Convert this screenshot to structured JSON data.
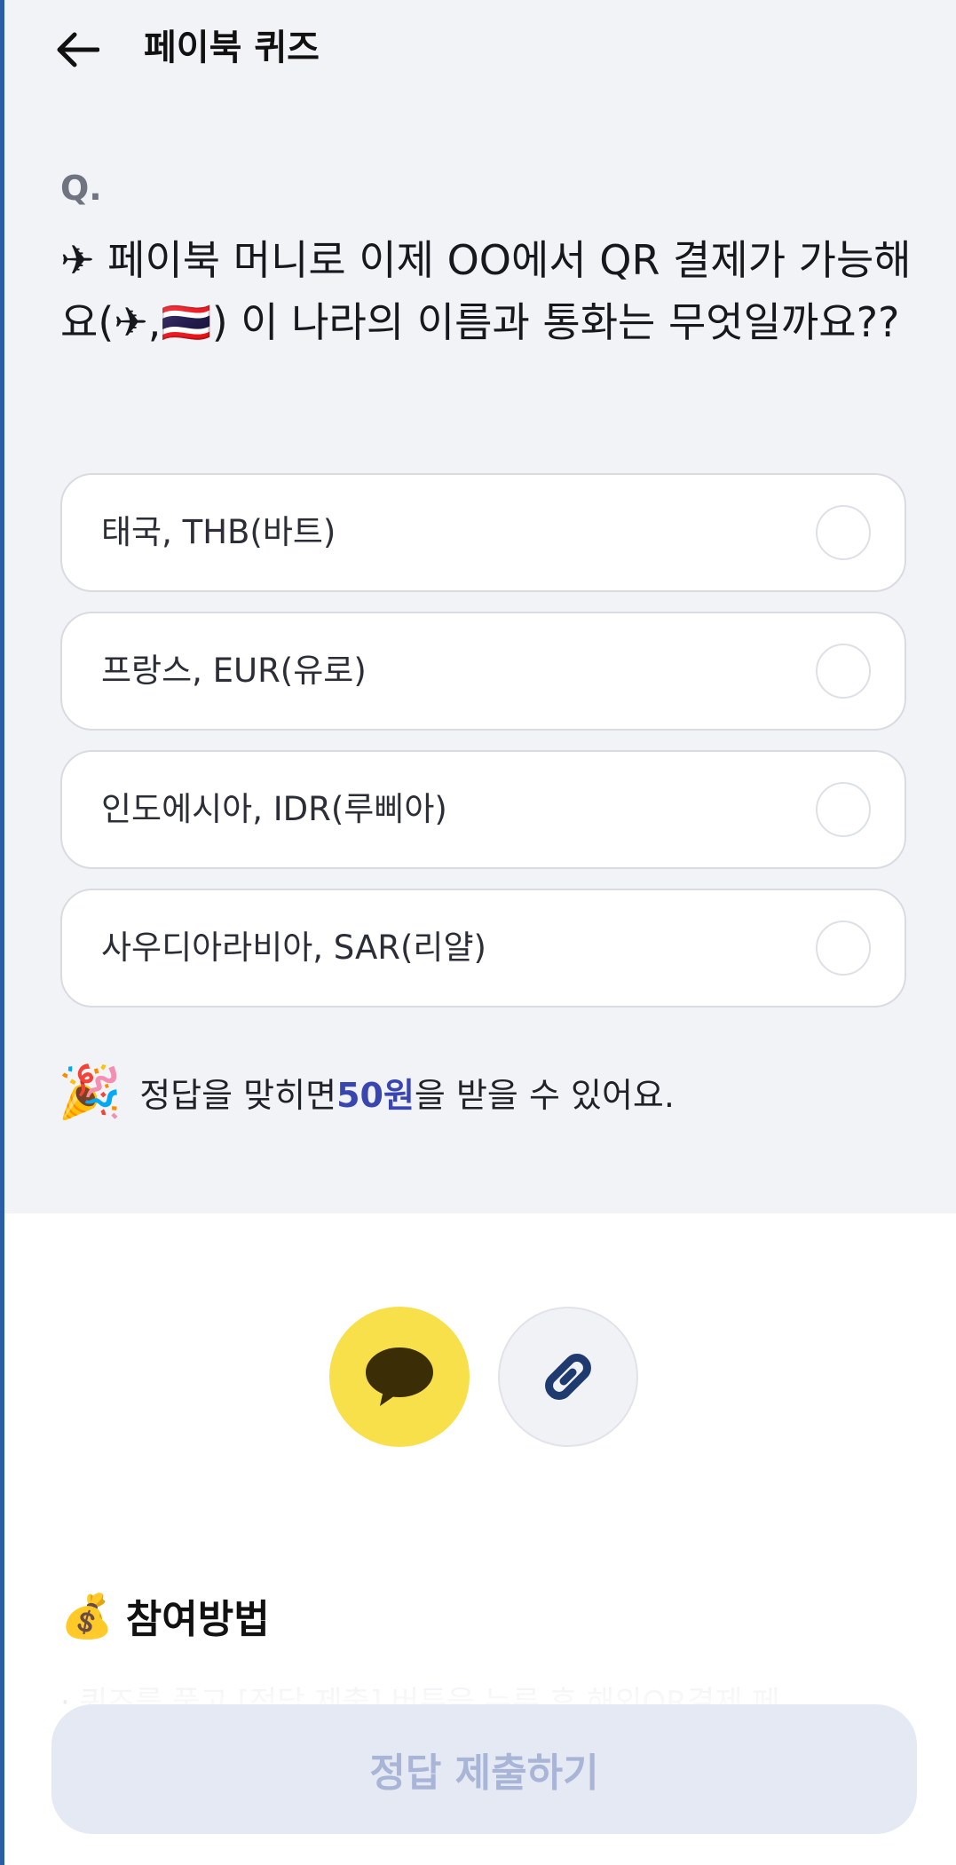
{
  "header": {
    "title": "페이북 퀴즈",
    "back_icon": "arrow-left-icon"
  },
  "quiz": {
    "q_label": "Q.",
    "question": "✈ 페이북 머니로 이제 OO에서 QR 결제가 가능해요(✈,🇹🇭) 이 나라의 이름과 통화는 무엇일까요??",
    "options": [
      {
        "label": "태국, THB(바트)",
        "selected": false
      },
      {
        "label": "프랑스, EUR(유로)",
        "selected": false
      },
      {
        "label": "인도에시아, IDR(루삐아)",
        "selected": false
      },
      {
        "label": "사우디아라비아, SAR(리얄)",
        "selected": false
      }
    ],
    "reward": {
      "emoji": "🎉",
      "prefix": "정답을 맞히면 ",
      "amount": "50원",
      "suffix": "을 받을 수 있어요."
    }
  },
  "share": {
    "kakao_icon": "kakao-talk-icon",
    "link_icon": "link-icon",
    "kakao_color": "#f8e04b"
  },
  "how_to": {
    "emoji": "💰",
    "title": "참여방법",
    "first_line": "· 퀴즈를 풀고 [정답 제출] 버튼을 누른 후 해외QR결제 페"
  },
  "submit": {
    "label": "정답 제출하기"
  },
  "colors": {
    "accent": "#3a46b0",
    "background_top": "#f2f3f7",
    "submit_bg": "#e5e9f3",
    "submit_text": "#a9b5d6"
  }
}
